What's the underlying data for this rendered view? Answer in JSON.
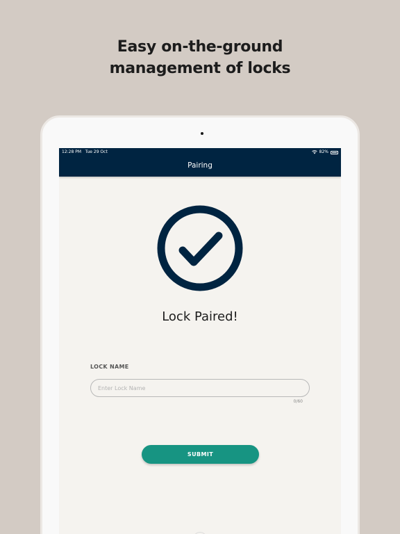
{
  "headline": {
    "line1": "Easy on-the-ground",
    "line2": "management of locks"
  },
  "statusbar": {
    "time": "12:28 PM",
    "date": "Tue 29 Oct",
    "battery": "82%"
  },
  "navbar": {
    "title": "Pairing"
  },
  "main": {
    "success_title": "Lock Paired!",
    "lock_name_label": "LOCK NAME",
    "lock_name_placeholder": "Enter Lock Name",
    "lock_name_value": "",
    "char_count": "0/60",
    "submit_label": "SUBMIT"
  },
  "colors": {
    "background": "#d3cbc4",
    "navbar": "#002441",
    "accent": "#179482",
    "screen": "#f5f3ef"
  }
}
